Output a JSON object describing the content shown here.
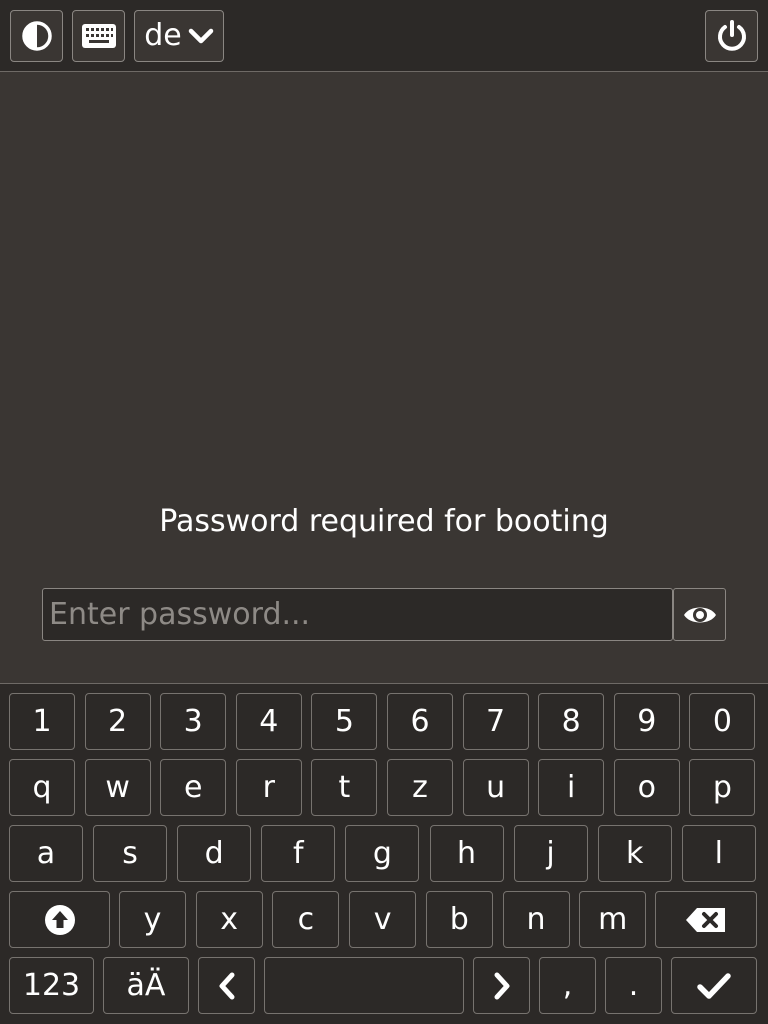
{
  "topbar": {
    "contrast_icon": "contrast-icon",
    "keyboard_icon": "keyboard-icon",
    "layout_label": "de",
    "layout_chevron_icon": "chevron-down-icon",
    "power_icon": "power-icon"
  },
  "prompt": {
    "message": "Password required for booting",
    "placeholder": "Enter password...",
    "reveal_icon": "eye-icon"
  },
  "keyboard": {
    "row1": [
      "1",
      "2",
      "3",
      "4",
      "5",
      "6",
      "7",
      "8",
      "9",
      "0"
    ],
    "row2": [
      "q",
      "w",
      "e",
      "r",
      "t",
      "z",
      "u",
      "i",
      "o",
      "p"
    ],
    "row3": [
      "a",
      "s",
      "d",
      "f",
      "g",
      "h",
      "j",
      "k",
      "l"
    ],
    "row4": [
      "y",
      "x",
      "c",
      "v",
      "b",
      "n",
      "m"
    ],
    "shift_icon": "shift-icon",
    "backspace_icon": "backspace-icon",
    "numbers_label": "123",
    "umlaut_label": "äÄ",
    "left_icon": "chevron-left-icon",
    "right_icon": "chevron-right-icon",
    "comma_label": ",",
    "period_label": ".",
    "enter_icon": "checkmark-icon"
  },
  "colors": {
    "background": "#3a3633",
    "bar": "#2c2927",
    "border": "#8a8682",
    "text": "#ffffff",
    "placeholder": "#8e8a86"
  }
}
